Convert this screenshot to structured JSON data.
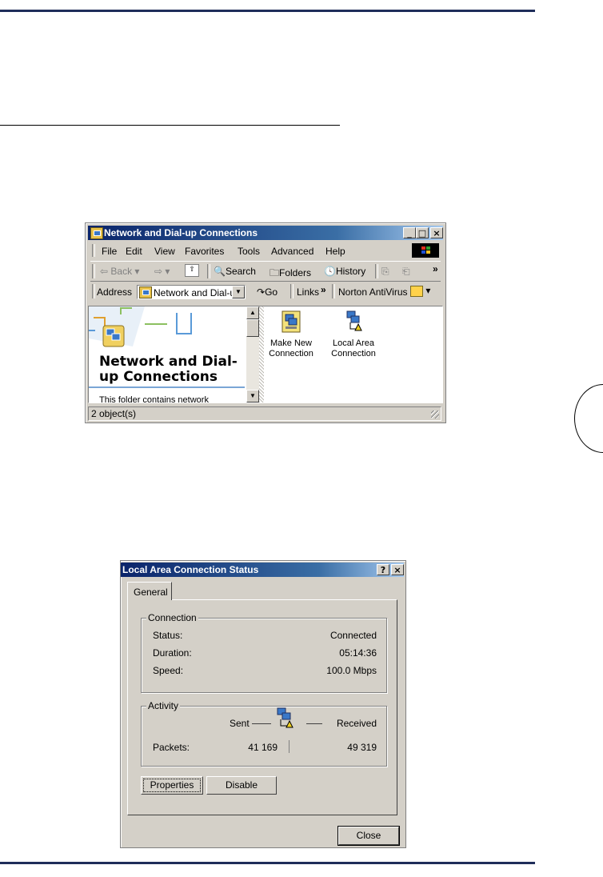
{
  "window1": {
    "title": "Network and Dial-up Connections",
    "controls": {
      "minimize": "_",
      "maximize": "□",
      "close": "×"
    },
    "menu": [
      "File",
      "Edit",
      "View",
      "Favorites",
      "Tools",
      "Advanced",
      "Help"
    ],
    "toolbar": {
      "back": "Back",
      "search": "Search",
      "folders": "Folders",
      "history": "History",
      "overflow": "»"
    },
    "address": {
      "label": "Address",
      "value": "Network and Dial-u",
      "go": "Go",
      "links": "Links",
      "links_overflow": "»",
      "norton": "Norton AntiVirus"
    },
    "banner": {
      "title_line1": "Network and Dial-",
      "title_line2": "up Connections",
      "description": "This folder contains network"
    },
    "items": [
      {
        "line1": "Make New",
        "line2": "Connection",
        "icon": "new-connection-icon"
      },
      {
        "line1": "Local Area",
        "line2": "Connection",
        "icon": "network-connection-icon"
      }
    ],
    "status": "2 object(s)"
  },
  "window2": {
    "title": "Local Area Connection Status",
    "controls": {
      "help": "?",
      "close": "×"
    },
    "tab": "General",
    "connection": {
      "group_label": "Connection",
      "rows": [
        {
          "label": "Status:",
          "value": "Connected"
        },
        {
          "label": "Duration:",
          "value": "05:14:36"
        },
        {
          "label": "Speed:",
          "value": "100.0 Mbps"
        }
      ]
    },
    "activity": {
      "group_label": "Activity",
      "sent_label": "Sent",
      "received_label": "Received",
      "packets_label": "Packets:",
      "sent": "41 169",
      "received": "49 319"
    },
    "buttons": {
      "properties": "Properties",
      "disable": "Disable",
      "close": "Close"
    }
  },
  "colors": {
    "rule": "#1f2d5a",
    "title_start": "#0a246a",
    "title_end": "#a6caf0",
    "face": "#d4d0c8"
  }
}
